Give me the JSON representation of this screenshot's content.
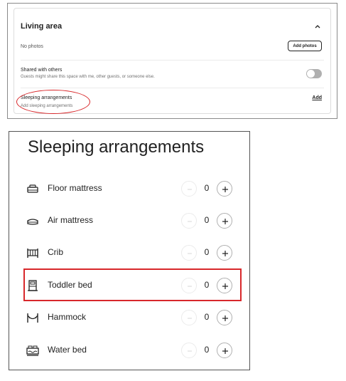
{
  "living_area": {
    "title": "Living area",
    "photos_status": "No photos",
    "add_photos_label": "Add photos",
    "shared_title": "Shared with others",
    "shared_subtitle": "Guests might share this space with me, other guests, or someone else.",
    "shared_toggle_on": false,
    "sleeping_title": "Sleeping arrangements",
    "sleeping_subtitle": "Add sleeping arrangements",
    "add_label": "Add"
  },
  "sleeping": {
    "title": "Sleeping arrangements",
    "items": [
      {
        "label": "Floor mattress",
        "count": "0",
        "icon": "floor-mattress-icon"
      },
      {
        "label": "Air mattress",
        "count": "0",
        "icon": "air-mattress-icon"
      },
      {
        "label": "Crib",
        "count": "0",
        "icon": "crib-icon"
      },
      {
        "label": "Toddler bed",
        "count": "0",
        "icon": "toddler-bed-icon"
      },
      {
        "label": "Hammock",
        "count": "0",
        "icon": "hammock-icon"
      },
      {
        "label": "Water bed",
        "count": "0",
        "icon": "water-bed-icon"
      }
    ]
  },
  "colors": {
    "highlight": "#d8282b",
    "text": "#222222"
  }
}
